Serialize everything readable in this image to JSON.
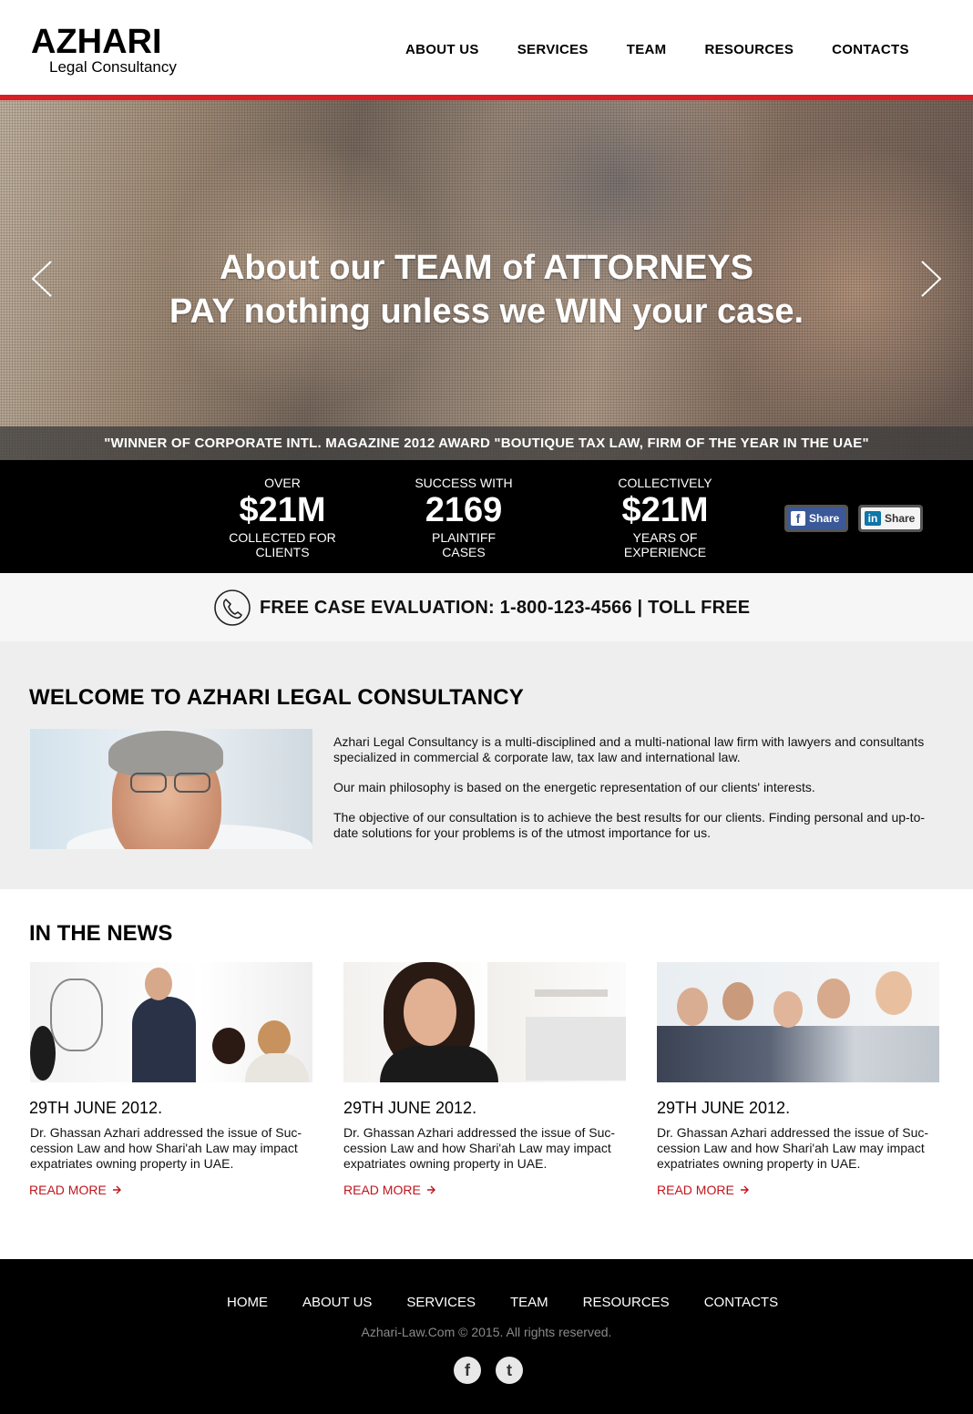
{
  "brand": {
    "name": "AZHARI",
    "tagline": "Legal Consultancy"
  },
  "nav": {
    "items": [
      "ABOUT US",
      "SERVICES",
      "TEAM",
      "RESOURCES",
      "CONTACTS"
    ]
  },
  "hero": {
    "line1": "About our TEAM of ATTORNEYS",
    "line2": "PAY nothing unless we WIN your case.",
    "award": "\"WINNER OF CORPORATE INTL. MAGAZINE 2012 AWARD \"BOUTIQUE TAX LAW, FIRM OF THE YEAR IN THE UAE\""
  },
  "stats": [
    {
      "top": "OVER",
      "value": "$21M",
      "bottom1": "COLLECTED FOR",
      "bottom2": "CLIENTS"
    },
    {
      "top": "SUCCESS WITH",
      "value": "2169",
      "bottom1": "PLAINTIFF",
      "bottom2": "CASES"
    },
    {
      "top": "COLLECTIVELY",
      "value": "$21M",
      "bottom1": "YEARS OF",
      "bottom2": "EXPERIENCE"
    }
  ],
  "share": {
    "facebook_label": "Share",
    "linkedin_label": "Share",
    "linkedin_glyph": "in",
    "facebook_glyph": "f"
  },
  "evaluation": {
    "text": "FREE CASE EVALUATION: 1-800-123-4566 | TOLL FREE",
    "icon": "phone-icon"
  },
  "welcome": {
    "title": "WELCOME TO AZHARI LEGAL CONSULTANCY",
    "paragraphs": [
      "Azhari Legal Consultancy is a multi-disciplined and a multi-national law firm with lawyers and consultants specialized in commercial & corporate law, tax law and international law.",
      "Our main philosophy is based on the energetic representation of our clients' interests.",
      "The objective of our consultation is to achieve the best results for our clients. Finding personal and up-to-date solutions for your problems is of the utmost importance for us."
    ]
  },
  "news": {
    "title": "IN THE NEWS",
    "items": [
      {
        "date": "29TH JUNE 2012.",
        "desc": "Dr. Ghassan Azhari addressed the issue of Suc-cession Law and how Shari'ah Law may impact expatriates owning property in UAE.",
        "more": "READ MORE"
      },
      {
        "date": "29TH JUNE 2012.",
        "desc": "Dr. Ghassan Azhari addressed the issue of Suc-cession Law and how Shari'ah Law may impact expatriates owning property in UAE.",
        "more": "READ MORE"
      },
      {
        "date": "29TH JUNE 2012.",
        "desc": "Dr. Ghassan Azhari addressed the issue of Suc-cession Law and how Shari'ah Law may impact expatriates owning property in UAE.",
        "more": "READ MORE"
      }
    ]
  },
  "footer": {
    "nav": [
      "HOME",
      "ABOUT US",
      "SERVICES",
      "TEAM",
      "RESOURCES",
      "CONTACTS"
    ],
    "copyright": "Azhari-Law.Com © 2015. All rights reserved.",
    "social_fb_glyph": "f",
    "social_tw_glyph": "t"
  },
  "colors": {
    "accent": "#d81f26",
    "link": "#c0141b",
    "dark": "#000000"
  }
}
